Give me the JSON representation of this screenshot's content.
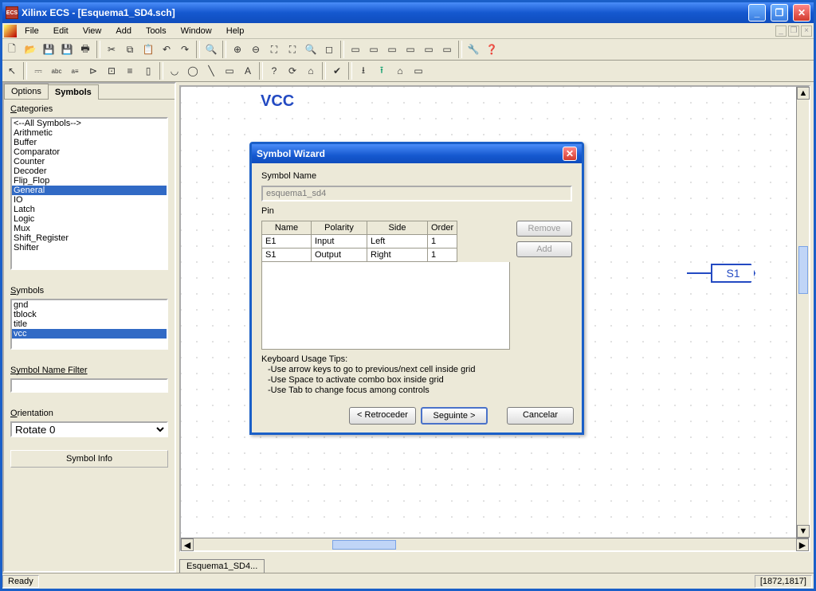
{
  "window": {
    "title": "Xilinx ECS - [Esquema1_SD4.sch]"
  },
  "menu": {
    "items": [
      "File",
      "Edit",
      "View",
      "Add",
      "Tools",
      "Window",
      "Help"
    ]
  },
  "sidebar": {
    "tab_options": "Options",
    "tab_symbols": "Symbols",
    "categories_label": "Categories",
    "categories": [
      "<--All Symbols-->",
      "Arithmetic",
      "Buffer",
      "Comparator",
      "Counter",
      "Decoder",
      "Flip_Flop",
      "General",
      "IO",
      "Latch",
      "Logic",
      "Mux",
      "Shift_Register",
      "Shifter"
    ],
    "categories_selected": "General",
    "symbols_label": "Symbols",
    "symbols": [
      "gnd",
      "tblock",
      "title",
      "vcc"
    ],
    "symbols_selected": "vcc",
    "filter_label": "Symbol Name Filter",
    "orientation_label": "Orientation",
    "orientation_value": "Rotate 0",
    "info_button": "Symbol Info"
  },
  "canvas": {
    "vcc_label": "VCC",
    "port_label": "S1",
    "tab": "Esquema1_SD4..."
  },
  "dialog": {
    "title": "Symbol Wizard",
    "name_label": "Symbol Name",
    "name_value": "esquema1_sd4",
    "pin_label": "Pin",
    "headers": {
      "name": "Name",
      "polarity": "Polarity",
      "side": "Side",
      "order": "Order"
    },
    "rows": [
      {
        "name": "E1",
        "polarity": "Input",
        "side": "Left",
        "order": "1"
      },
      {
        "name": "S1",
        "polarity": "Output",
        "side": "Right",
        "order": "1"
      }
    ],
    "remove": "Remove",
    "add": "Add",
    "tips_title": "Keyboard Usage Tips:",
    "tip1": "-Use arrow keys to go to previous/next cell inside grid",
    "tip2": "-Use Space to activate combo box inside grid",
    "tip3": "-Use Tab to change focus among controls",
    "back": "< Retroceder",
    "next": "Seguinte >",
    "cancel": "Cancelar"
  },
  "status": {
    "ready": "Ready",
    "coords": "[1872,1817]"
  }
}
